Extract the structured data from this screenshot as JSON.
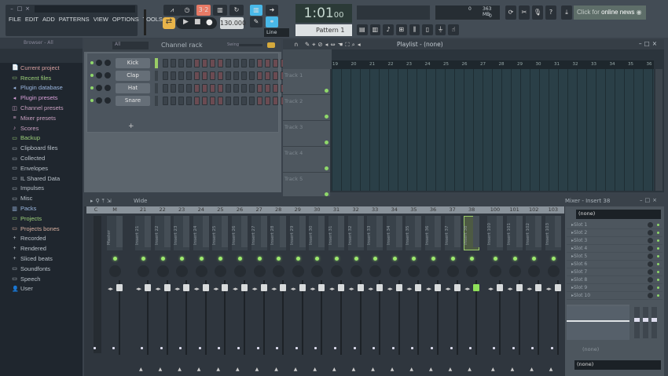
{
  "menu": [
    "FILE",
    "EDIT",
    "ADD",
    "PATTERNS",
    "VIEW",
    "OPTIONS",
    "TOOLS",
    "?"
  ],
  "transport": {
    "tempo": "130.000",
    "time": "1:01",
    "time_sub": "00",
    "pattern": "Pattern 1",
    "snap": "Line"
  },
  "monitor": {
    "cpu": "0",
    "memory": "363 MB",
    "poly": "0"
  },
  "news": {
    "prefix": "Click for ",
    "bold": "online news"
  },
  "browser": {
    "title": "Browser - All",
    "items": [
      {
        "label": "Current project",
        "color": "#d9a0a0",
        "icon": "📄"
      },
      {
        "label": "Recent files",
        "color": "#9ed27a",
        "icon": "▭"
      },
      {
        "label": "Plugin database",
        "color": "#9bb7e0",
        "icon": "◂"
      },
      {
        "label": "Plugin presets",
        "color": "#d8a0d8",
        "icon": "◂"
      },
      {
        "label": "Channel presets",
        "color": "#c9a0c0",
        "icon": "◫"
      },
      {
        "label": "Mixer presets",
        "color": "#c9a0c0",
        "icon": "≡"
      },
      {
        "label": "Scores",
        "color": "#c9a0c0",
        "icon": "♪"
      },
      {
        "label": "Backup",
        "color": "#9ed27a",
        "icon": "▭"
      },
      {
        "label": "Clipboard files",
        "color": "#b8c0c8",
        "icon": "▭"
      },
      {
        "label": "Collected",
        "color": "#b8c0c8",
        "icon": "▭"
      },
      {
        "label": "Envelopes",
        "color": "#b8c0c8",
        "icon": "▭"
      },
      {
        "label": "IL Shared Data",
        "color": "#b8c0c8",
        "icon": "▭"
      },
      {
        "label": "Impulses",
        "color": "#b8c0c8",
        "icon": "▭"
      },
      {
        "label": "Misc",
        "color": "#b8c0c8",
        "icon": "▭"
      },
      {
        "label": "Packs",
        "color": "#9bb7e0",
        "icon": "▥"
      },
      {
        "label": "Projects",
        "color": "#9ed27a",
        "icon": "▭"
      },
      {
        "label": "Projects bones",
        "color": "#d9b0a0",
        "icon": "▭"
      },
      {
        "label": "Recorded",
        "color": "#b8c0c8",
        "icon": "+"
      },
      {
        "label": "Rendered",
        "color": "#b8c0c8",
        "icon": "+"
      },
      {
        "label": "Sliced beats",
        "color": "#b8c0c8",
        "icon": "+"
      },
      {
        "label": "Soundfonts",
        "color": "#b8c0c8",
        "icon": "▭"
      },
      {
        "label": "Speech",
        "color": "#b8c0c8",
        "icon": "▭"
      },
      {
        "label": "User",
        "color": "#b8c0c8",
        "icon": "👤"
      }
    ]
  },
  "channel_rack": {
    "title": "Channel rack",
    "filter": "All",
    "swing_label": "Swing",
    "channels": [
      "Kick",
      "Clap",
      "Hat",
      "Snare"
    ]
  },
  "playlist": {
    "title": "Playlist - (none)",
    "ruler": [
      "19",
      "20",
      "21",
      "22",
      "23",
      "24",
      "25",
      "26",
      "27",
      "28",
      "29",
      "30",
      "31",
      "32",
      "33",
      "34",
      "35",
      "36"
    ],
    "tracks": [
      "Track 1",
      "Track 2",
      "Track 3",
      "Track 4",
      "Track 5"
    ]
  },
  "mixer": {
    "preset": "Wide",
    "title": "Mixer - Insert 38",
    "strips": [
      {
        "num": "C",
        "name": ""
      },
      {
        "num": "M",
        "name": "Master"
      },
      {
        "num": "21",
        "name": "Insert 21"
      },
      {
        "num": "22",
        "name": "Insert 22"
      },
      {
        "num": "23",
        "name": "Insert 23"
      },
      {
        "num": "24",
        "name": "Insert 24"
      },
      {
        "num": "25",
        "name": "Insert 25"
      },
      {
        "num": "26",
        "name": "Insert 26"
      },
      {
        "num": "27",
        "name": "Insert 27"
      },
      {
        "num": "28",
        "name": "Insert 28"
      },
      {
        "num": "29",
        "name": "Insert 29"
      },
      {
        "num": "30",
        "name": "Insert 30"
      },
      {
        "num": "31",
        "name": "Insert 31"
      },
      {
        "num": "32",
        "name": "Insert 32"
      },
      {
        "num": "33",
        "name": "Insert 33"
      },
      {
        "num": "34",
        "name": "Insert 34"
      },
      {
        "num": "35",
        "name": "Insert 35"
      },
      {
        "num": "36",
        "name": "Insert 36"
      },
      {
        "num": "37",
        "name": "Insert 37"
      },
      {
        "num": "38",
        "name": "Insert 38"
      },
      {
        "num": "100",
        "name": "Insert 100"
      },
      {
        "num": "101",
        "name": "Insert 101"
      },
      {
        "num": "102",
        "name": "Insert 102"
      },
      {
        "num": "103",
        "name": "Insert 103"
      }
    ],
    "selected": "38",
    "input": "(none)",
    "output": "(none)",
    "eq_label": "(none)",
    "slots": [
      "Slot 1",
      "Slot 2",
      "Slot 3",
      "Slot 4",
      "Slot 5",
      "Slot 6",
      "Slot 7",
      "Slot 8",
      "Slot 9",
      "Slot 10"
    ]
  }
}
